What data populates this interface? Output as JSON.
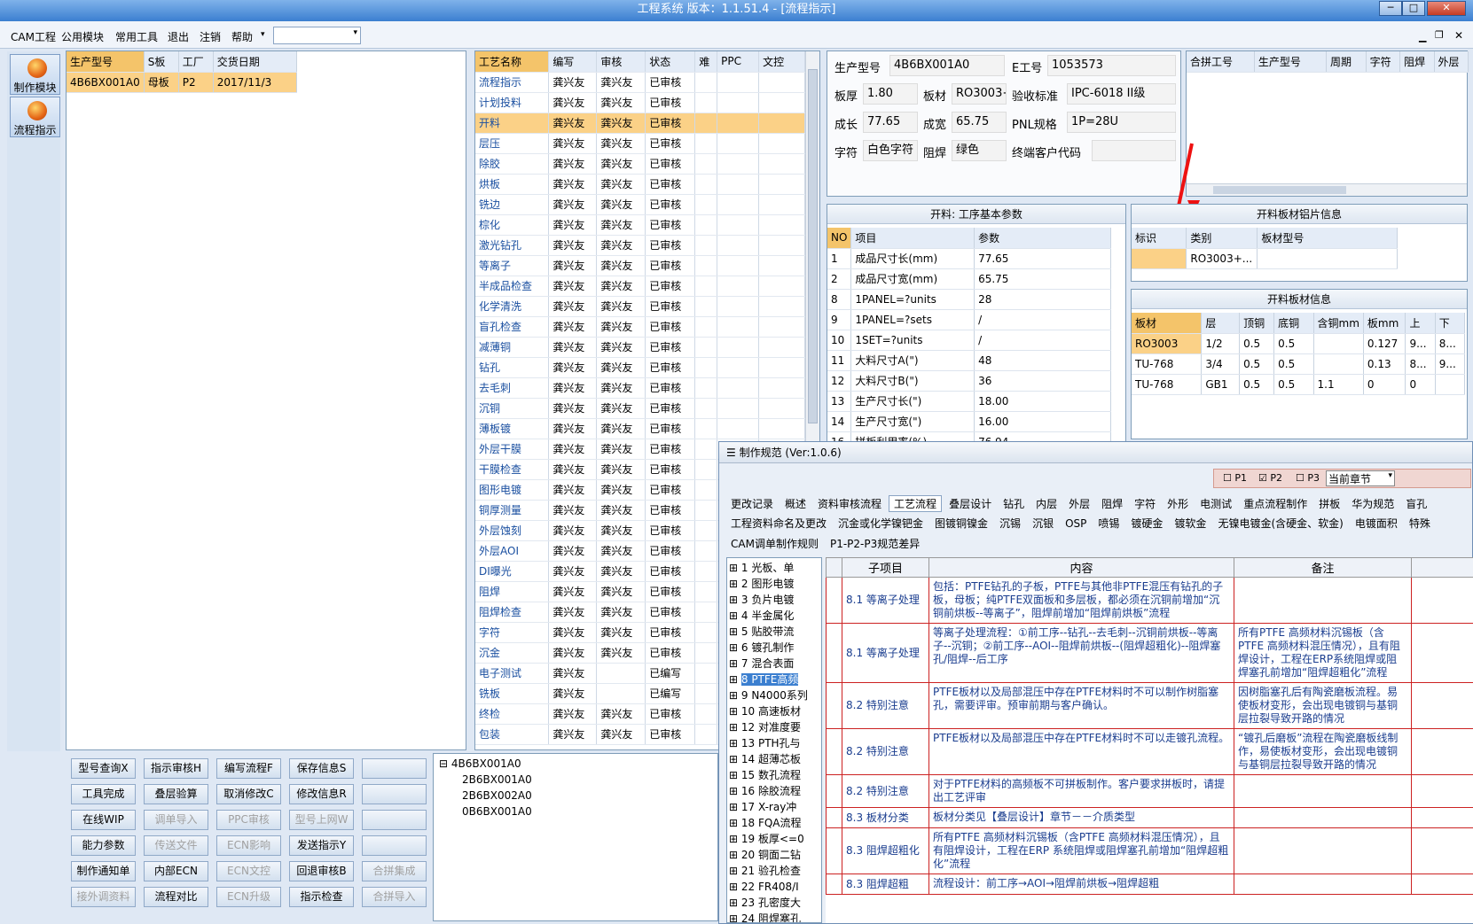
{
  "window": {
    "title": "工程系统  版本：1.1.51.4 - [流程指示]"
  },
  "menu": [
    "CAM工程",
    "公用模块",
    "常用工具",
    "退出",
    "注销",
    "帮助"
  ],
  "left_buttons": [
    "制作模块",
    "流程指示"
  ],
  "orders": {
    "headers": [
      "生产型号",
      "S板",
      "工厂",
      "交货日期"
    ],
    "rows": [
      [
        "4B6BX001A0",
        "母板",
        "P2",
        "2017/11/3"
      ]
    ]
  },
  "process": {
    "headers": [
      "工艺名称",
      "编写",
      "审核",
      "状态",
      "难",
      "PPC",
      "文控"
    ],
    "rows": [
      [
        "流程指示",
        "龚兴友",
        "龚兴友",
        "已审核"
      ],
      [
        "计划投料",
        "龚兴友",
        "龚兴友",
        "已审核"
      ],
      [
        "开料",
        "龚兴友",
        "龚兴友",
        "已审核"
      ],
      [
        "层压",
        "龚兴友",
        "龚兴友",
        "已审核"
      ],
      [
        "除胶",
        "龚兴友",
        "龚兴友",
        "已审核"
      ],
      [
        "烘板",
        "龚兴友",
        "龚兴友",
        "已审核"
      ],
      [
        "铣边",
        "龚兴友",
        "龚兴友",
        "已审核"
      ],
      [
        "棕化",
        "龚兴友",
        "龚兴友",
        "已审核"
      ],
      [
        "激光钻孔",
        "龚兴友",
        "龚兴友",
        "已审核"
      ],
      [
        "等离子",
        "龚兴友",
        "龚兴友",
        "已审核"
      ],
      [
        "半成品检查",
        "龚兴友",
        "龚兴友",
        "已审核"
      ],
      [
        "化学清洗",
        "龚兴友",
        "龚兴友",
        "已审核"
      ],
      [
        "盲孔检查",
        "龚兴友",
        "龚兴友",
        "已审核"
      ],
      [
        "减薄铜",
        "龚兴友",
        "龚兴友",
        "已审核"
      ],
      [
        "钻孔",
        "龚兴友",
        "龚兴友",
        "已审核"
      ],
      [
        "去毛刺",
        "龚兴友",
        "龚兴友",
        "已审核"
      ],
      [
        "沉铜",
        "龚兴友",
        "龚兴友",
        "已审核"
      ],
      [
        "薄板镀",
        "龚兴友",
        "龚兴友",
        "已审核"
      ],
      [
        "外层干膜",
        "龚兴友",
        "龚兴友",
        "已审核"
      ],
      [
        "干膜检查",
        "龚兴友",
        "龚兴友",
        "已审核"
      ],
      [
        "图形电镀",
        "龚兴友",
        "龚兴友",
        "已审核"
      ],
      [
        "铜厚测量",
        "龚兴友",
        "龚兴友",
        "已审核"
      ],
      [
        "外层蚀刻",
        "龚兴友",
        "龚兴友",
        "已审核"
      ],
      [
        "外层AOI",
        "龚兴友",
        "龚兴友",
        "已审核"
      ],
      [
        "DI曝光",
        "龚兴友",
        "龚兴友",
        "已审核"
      ],
      [
        "阻焊",
        "龚兴友",
        "龚兴友",
        "已审核"
      ],
      [
        "阻焊检查",
        "龚兴友",
        "龚兴友",
        "已审核"
      ],
      [
        "字符",
        "龚兴友",
        "龚兴友",
        "已审核"
      ],
      [
        "沉金",
        "龚兴友",
        "龚兴友",
        "已审核"
      ],
      [
        "电子测试",
        "龚兴友",
        "",
        "已编写"
      ],
      [
        "铣板",
        "龚兴友",
        "",
        "已编写"
      ],
      [
        "终检",
        "龚兴友",
        "龚兴友",
        "已审核"
      ],
      [
        "包装",
        "龚兴友",
        "龚兴友",
        "已审核"
      ]
    ]
  },
  "info": {
    "model_lbl": "生产型号",
    "model": "4B6BX001A0",
    "eno_lbl": "E工号",
    "eno": "1053573",
    "thick_lbl": "板厚",
    "thick": "1.80",
    "mat_lbl": "板材",
    "mat": "RO3003+",
    "std_lbl": "验收标准",
    "std": "IPC-6018 II级",
    "len_lbl": "成长",
    "len": "77.65",
    "wid_lbl": "成宽",
    "wid": "65.75",
    "pnl_lbl": "PNL规格",
    "pnl": "1P=28U",
    "char_lbl": "字符",
    "char": "白色字符",
    "mask_lbl": "阻焊",
    "mask": "绿色",
    "cust_lbl": "终端客户代码",
    "cust": ""
  },
  "merge": {
    "headers": [
      "合拼工号",
      "生产型号",
      "周期",
      "字符",
      "阻焊",
      "外层"
    ]
  },
  "params": {
    "title": "开料: 工序基本参数",
    "headers": [
      "NO",
      "项目",
      "参数"
    ],
    "rows": [
      [
        "1",
        "成品尺寸长(mm)",
        "77.65"
      ],
      [
        "2",
        "成品尺寸宽(mm)",
        "65.75"
      ],
      [
        "8",
        "1PANEL=?units",
        "28"
      ],
      [
        "9",
        "1PANEL=?sets",
        "/"
      ],
      [
        "10",
        "1SET=?units",
        "/"
      ],
      [
        "11",
        "大料尺寸A(\")",
        "48"
      ],
      [
        "12",
        "大料尺寸B(\")",
        "36"
      ],
      [
        "13",
        "生产尺寸长(\")",
        "18.00"
      ],
      [
        "14",
        "生产尺寸宽(\")",
        "16.00"
      ],
      [
        "16",
        "拼板利用率(%)",
        "76.94"
      ]
    ]
  },
  "alu": {
    "title": "开料板材铝片信息",
    "headers": [
      "标识",
      "类别",
      "板材型号"
    ],
    "rows": [
      [
        "",
        "RO3003+...",
        ""
      ]
    ]
  },
  "board": {
    "title": "开料板材信息",
    "headers": [
      "板材",
      "层",
      "顶铜",
      "底铜",
      "含铜mm",
      "板mm",
      "上",
      "下"
    ],
    "rows": [
      [
        "RO3003",
        "1/2",
        "0.5",
        "0.5",
        "",
        "0.127",
        "9...",
        "8..."
      ],
      [
        "TU-768",
        "3/4",
        "0.5",
        "0.5",
        "",
        "0.13",
        "8...",
        "9..."
      ],
      [
        "TU-768",
        "GB1",
        "0.5",
        "0.5",
        "1.1",
        "0",
        "0",
        ""
      ]
    ]
  },
  "buttons": [
    [
      "型号查询X",
      "指示审核H",
      "编写流程F",
      "保存信息S",
      ""
    ],
    [
      "工具完成",
      "叠层验算",
      "取消修改C",
      "修改信息R",
      ""
    ],
    [
      "在线WIP",
      "调单导入",
      "PPC审核",
      "型号上网W",
      ""
    ],
    [
      "能力参数",
      "传送文件",
      "ECN影响",
      "发送指示Y",
      ""
    ],
    [
      "制作通知单",
      "内部ECN",
      "ECN文控",
      "回退审核B",
      "合拼集成"
    ],
    [
      "接外调资料",
      "流程对比",
      "ECN升级",
      "指示检查",
      "合拼导入"
    ]
  ],
  "buttons_disabled": [
    [
      0,
      0,
      0,
      0,
      0
    ],
    [
      0,
      0,
      0,
      0,
      0
    ],
    [
      0,
      1,
      1,
      1,
      0
    ],
    [
      0,
      1,
      1,
      0,
      0
    ],
    [
      0,
      0,
      1,
      0,
      1
    ],
    [
      1,
      0,
      1,
      0,
      1
    ]
  ],
  "tree": [
    "4B6BX001A0",
    "2B6BX001A0",
    "2B6BX002A0",
    "0B6BX001A0"
  ],
  "dialog": {
    "title": "制作规范 (Ver:1.0.6)",
    "p1": "P1",
    "p2": "P2",
    "p3": "P3",
    "section": "当前章节",
    "tabs1": [
      "更改记录",
      "概述",
      "资料审核流程",
      "工艺流程",
      "叠层设计",
      "钻孔",
      "内层",
      "外层",
      "阻焊",
      "字符",
      "外形",
      "电测试",
      "重点流程制作",
      "拼板",
      "华为规范",
      "盲孔"
    ],
    "tabs2": [
      "工程资料命名及更改",
      "沉金或化学镍钯金",
      "图镀铜镍金",
      "沉锡",
      "沉银",
      "OSP",
      "喷锡",
      "镀硬金",
      "镀软金",
      "无镍电镀金(含硬金、软金)",
      "电镀面积",
      "特殊"
    ],
    "tabs3": [
      "CAM调单制作规则",
      "P1-P2-P3规范差异"
    ],
    "tree": [
      "1 光板、单",
      "2 图形电镀",
      "3 负片电镀",
      "4 半金属化",
      "5 贴胶带流",
      "6 镀孔制作",
      "7 混合表面",
      "8 PTFE高频",
      "9 N4000系列",
      "10 高速板材",
      "12 对准度要",
      "13 PTH孔与",
      "14 超薄芯板",
      "15 数孔流程",
      "16 除胶流程",
      "17 X-ray冲",
      "18 FQA流程",
      "19 板厚<=0",
      "20 铜面二钻",
      "21 验孔检查",
      "22 FR408/I",
      "23 孔密度大",
      "24 阻焊塞孔"
    ],
    "headers": [
      "子项目",
      "内容",
      "备注"
    ],
    "rows": [
      [
        "8.1 等离子处理",
        "包括：PTFE钻孔的子板，PTFE与其他非PTFE混压有钻孔的子板，母板；纯PTFE双面板和多层板，都必须在沉铜前增加“沉铜前烘板--等离子”，阻焊前增加“阻焊前烘板”流程",
        ""
      ],
      [
        "8.1 等离子处理",
        "等离子处理流程：①前工序--钻孔--去毛刺--沉铜前烘板--等离子--沉铜；②前工序--AOI--阻焊前烘板--(阻焊超粗化)--阻焊塞孔/阻焊--后工序",
        "所有PTFE 高频材料沉锡板（含PTFE 高频材料混压情况），且有阻焊设计，工程在ERP系统阻焊或阻焊塞孔前增加“阻焊超粗化”流程"
      ],
      [
        "8.2 特别注意",
        "PTFE板材以及局部混压中存在PTFE材料时不可以制作树脂塞孔，需要评审。预审前期与客户确认。",
        "因树脂塞孔后有陶瓷磨板流程。易使板材变形，会出现电镀铜与基铜层拉裂导致开路的情况"
      ],
      [
        "8.2 特别注意",
        "PTFE板材以及局部混压中存在PTFE材料时不可以走镀孔流程。",
        "“镀孔后磨板”流程在陶瓷磨板线制作，易使板材变形，会出现电镀铜与基铜层拉裂导致开路的情况"
      ],
      [
        "8.2 特别注意",
        "对于PTFE材料的高频板不可拼板制作。客户要求拼板时，请提出工艺评审",
        ""
      ],
      [
        "8.3 板材分类",
        "板材分类见【叠层设计】章节－－介质类型",
        ""
      ],
      [
        "8.3 阻焊超粗化",
        "所有PTFE 高频材料沉锡板（含PTFE 高频材料混压情况），且有阻焊设计，工程在ERP 系统阻焊或阻焊塞孔前增加“阻焊超粗化”流程",
        ""
      ],
      [
        "8.3 阻焊超粗",
        "流程设计：前工序→AOI→阻焊前烘板→阻焊超粗",
        ""
      ]
    ]
  }
}
